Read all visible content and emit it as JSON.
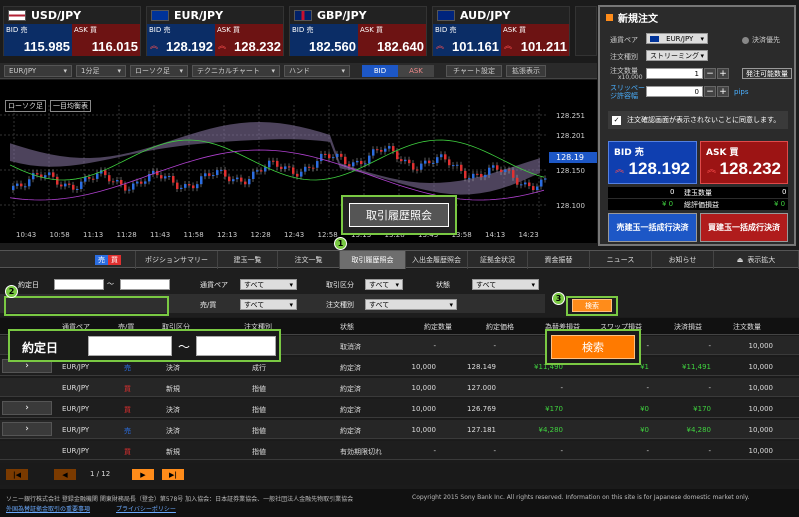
{
  "tiles": [
    {
      "pair": "USD/JPY",
      "bid_label": "BID 売",
      "ask_label": "ASK 買",
      "bid_price": "115.985",
      "ask_price": "116.015",
      "flag_color": "#b22234"
    },
    {
      "pair": "EUR/JPY",
      "bid_label": "BID 売",
      "ask_label": "ASK 買",
      "bid_price": "128.192",
      "ask_price": "128.232",
      "flag_color": "#003399"
    },
    {
      "pair": "GBP/JPY",
      "bid_label": "BID 売",
      "ask_label": "ASK 買",
      "bid_price": "182.560",
      "ask_price": "182.640",
      "flag_color": "#012169"
    },
    {
      "pair": "AUD/JPY",
      "bid_label": "BID 売",
      "ask_label": "ASK 買",
      "bid_price": "101.161",
      "ask_price": "101.211",
      "flag_color": "#00247d"
    }
  ],
  "chart_toolbar": {
    "pair": "EUR/JPY",
    "timeframe": "1分足",
    "chart_type": "ローソク足",
    "technical": "テクニカルチャート",
    "drawing": "ハンド",
    "bid": "BID",
    "ask": "ASK",
    "settings": "チャート設定",
    "expand": "拡張表示"
  },
  "chart": {
    "legend_candle": "ローソク足",
    "legend_ichimoku": "一目均衡表",
    "price_labels": [
      "128.251",
      "128.201",
      "128.150",
      "128.100"
    ],
    "current_price": "128.19",
    "time_labels": [
      "10:43",
      "10:58",
      "11:13",
      "11:28",
      "11:43",
      "11:58",
      "12:13",
      "12:28",
      "12:43",
      "12:58",
      "13:13",
      "13:28",
      "13:43",
      "13:58",
      "14:13",
      "14:23"
    ]
  },
  "order_panel": {
    "title": "新規注文",
    "quick_order": "決済優先",
    "pair_label": "通貨ペア",
    "pair_value": "EUR/JPY",
    "type_label": "注文種別",
    "type_value": "ストリーミング",
    "qty_label": "注文数量",
    "qty_unit": "x10,000",
    "qty_value": "1",
    "max_button": "発注可能数量",
    "slippage_label": "スリッページ許容幅",
    "slippage_value": "0",
    "pips": "pips",
    "confirm_text": "注文確認画面が表示されないことに同意します。",
    "bid_label": "BID 売",
    "ask_label": "ASK 買",
    "bid_price": "128.192",
    "ask_price": "128.232",
    "position_qty_label": "建玉数量",
    "position_qty_left": "0",
    "position_qty_right": "0",
    "pl_label": "総評価損益",
    "pl_left": "¥ 0",
    "pl_right": "¥ 0",
    "sell_all": "売建玉一括成行決済",
    "buy_all": "買建玉一括成行決済"
  },
  "tabs": [
    "ポジションサマリー",
    "建玉一覧",
    "注文一覧",
    "取引履歴照会",
    "入出金履歴照会",
    "証拠金状況",
    "資金振替",
    "ニュース",
    "お知らせ",
    "表示拡大"
  ],
  "tab_left_sell": "売",
  "tab_left_buy": "買",
  "filter": {
    "date_label": "約定日",
    "pair_label": "通貨ペア",
    "pair_value": "すべて",
    "trade_type_label": "取引区分",
    "trade_type_value": "すべて",
    "status_label": "状態",
    "status_value": "すべて",
    "side_label": "売/買",
    "side_value": "すべて",
    "order_type_label": "注文種別",
    "order_type_value": "すべて",
    "search": "検索",
    "range_sep": "～"
  },
  "table_headers": [
    "通貨ペア",
    "売/買",
    "取引区分",
    "注文種別",
    "状態",
    "約定数量",
    "約定価格",
    "為替差損益",
    "スワップ損益",
    "決済損益",
    "注文数量"
  ],
  "rows": [
    {
      "pair": "",
      "side": "",
      "kind": "",
      "type": "",
      "status": "取消済",
      "qty": "-",
      "price": "-",
      "fx": "-",
      "swap": "-",
      "settle": "-",
      "order_qty": "10,000",
      "arrow": false
    },
    {
      "pair": "EUR/JPY",
      "side": "売",
      "kind": "決済",
      "type": "成行",
      "status": "約定済",
      "qty": "10,000",
      "price": "128.149",
      "fx": "¥11,490",
      "swap": "¥1",
      "settle": "¥11,491",
      "order_qty": "10,000",
      "arrow": true
    },
    {
      "pair": "EUR/JPY",
      "side": "買",
      "kind": "新規",
      "type": "指値",
      "status": "約定済",
      "qty": "10,000",
      "price": "127.000",
      "fx": "-",
      "swap": "-",
      "settle": "-",
      "order_qty": "10,000",
      "arrow": false
    },
    {
      "pair": "EUR/JPY",
      "side": "買",
      "kind": "決済",
      "type": "指値",
      "status": "約定済",
      "qty": "10,000",
      "price": "126.769",
      "fx": "¥170",
      "swap": "¥0",
      "settle": "¥170",
      "order_qty": "10,000",
      "arrow": true
    },
    {
      "pair": "EUR/JPY",
      "side": "売",
      "kind": "決済",
      "type": "指値",
      "status": "約定済",
      "qty": "10,000",
      "price": "127.181",
      "fx": "¥4,280",
      "swap": "¥0",
      "settle": "¥4,280",
      "order_qty": "10,000",
      "arrow": true
    },
    {
      "pair": "EUR/JPY",
      "side": "買",
      "kind": "新規",
      "type": "指値",
      "status": "有効期限切れ",
      "qty": "-",
      "price": "-",
      "fx": "-",
      "swap": "-",
      "settle": "-",
      "order_qty": "10,000",
      "arrow": false
    }
  ],
  "pager": {
    "page": "1 / 12"
  },
  "footer": {
    "company": "ソニー銀行株式会社 登録金融機関 関東財務局長（登金）第578号 加入協会：日本証券業協会、一般社団法人金融先物取引業協会",
    "copyright": "Copyright 2015 Sony Bank Inc. All rights reserved. Information on this site is for Japanese domestic market only.",
    "link1": "外国為替証拠金取引の重要事項",
    "link2": "プライバシーポリシー"
  },
  "callouts": {
    "badge1": "1",
    "badge2": "2",
    "badge3": "3",
    "tab_zoom": "取引履歴照会",
    "date_zoom": "約定日",
    "sep_zoom": "～",
    "search_zoom": "検索"
  },
  "colors": {
    "sell": "#2b6de0",
    "buy": "#e03030",
    "gain": "#3fd13f",
    "orange": "#ff7a00",
    "callout": "#7ac943"
  }
}
